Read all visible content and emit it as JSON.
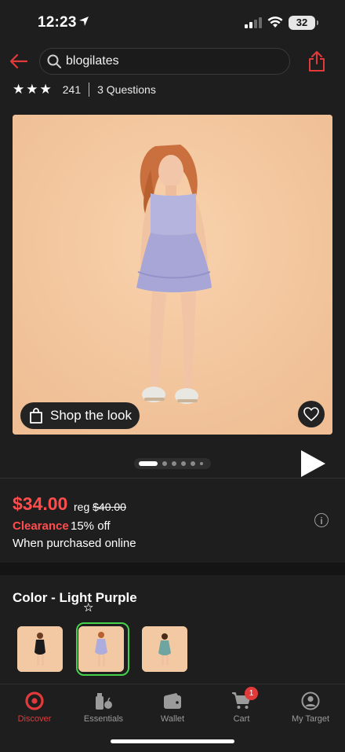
{
  "status_bar": {
    "time": "12:23",
    "battery": "32"
  },
  "header": {
    "search_text": "blogilates"
  },
  "rating": {
    "stars": 3,
    "max_stars": 5,
    "count": "241",
    "questions": "3 Questions"
  },
  "hero": {
    "shop_the_look": "Shop the look",
    "carousel_total": 6,
    "carousel_active": 0
  },
  "price": {
    "current": "$34.00",
    "reg_label": "reg",
    "regular": "$40.00",
    "clearance": "Clearance",
    "discount": "15% off",
    "note": "When purchased online"
  },
  "color": {
    "title": "Color - Light Purple",
    "selected_index": 1
  },
  "tabs": [
    {
      "label": "Discover",
      "icon": "target-logo-icon",
      "active": true
    },
    {
      "label": "Essentials",
      "icon": "essentials-icon",
      "active": false
    },
    {
      "label": "Wallet",
      "icon": "wallet-icon",
      "active": false
    },
    {
      "label": "Cart",
      "icon": "cart-icon",
      "active": false,
      "badge": "1"
    },
    {
      "label": "My Target",
      "icon": "account-icon",
      "active": false
    }
  ],
  "colors": {
    "accent_red": "#e23a3a",
    "price_red": "#ff4d4d",
    "swatch_selected": "#46d24a",
    "background": "#1e1e1e"
  }
}
